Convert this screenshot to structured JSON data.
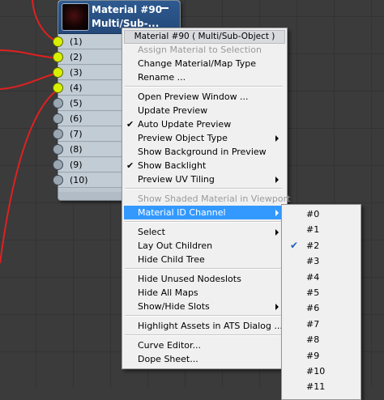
{
  "node": {
    "title": "Material #90",
    "subtitle": "Multi/Sub-...",
    "slots": [
      {
        "label": "(1)",
        "connected": true
      },
      {
        "label": "(2)",
        "connected": true
      },
      {
        "label": "(3)",
        "connected": true
      },
      {
        "label": "(4)",
        "connected": true
      },
      {
        "label": "(5)",
        "connected": false
      },
      {
        "label": "(6)",
        "connected": false
      },
      {
        "label": "(7)",
        "connected": false
      },
      {
        "label": "(8)",
        "connected": false
      },
      {
        "label": "(9)",
        "connected": false
      },
      {
        "label": "(10)",
        "connected": false
      }
    ]
  },
  "menu": {
    "header": "Material #90  ( Multi/Sub-Object )",
    "items": [
      {
        "label": "Assign Material to Selection",
        "disabled": true
      },
      {
        "label": "Change Material/Map Type"
      },
      {
        "label": "Rename ..."
      },
      {
        "label": "Open Preview Window ..."
      },
      {
        "label": "Update Preview"
      },
      {
        "label": "Auto Update Preview",
        "checked": true
      },
      {
        "label": "Preview Object Type",
        "submenu": true
      },
      {
        "label": "Show Background in Preview"
      },
      {
        "label": "Show Backlight",
        "checked": true
      },
      {
        "label": "Preview UV Tiling",
        "submenu": true
      },
      {
        "label": "Show Shaded Material in Viewport",
        "disabled": true
      },
      {
        "label": "Material ID Channel",
        "submenu": true,
        "highlighted": true
      },
      {
        "label": "Select",
        "submenu": true
      },
      {
        "label": "Lay Out Children"
      },
      {
        "label": "Hide Child Tree"
      },
      {
        "label": "Hide Unused Nodeslots"
      },
      {
        "label": "Hide All Maps"
      },
      {
        "label": "Show/Hide Slots",
        "submenu": true
      },
      {
        "label": "Highlight Assets in ATS Dialog ..."
      },
      {
        "label": "Curve Editor..."
      },
      {
        "label": "Dope Sheet..."
      }
    ]
  },
  "submenu": {
    "items": [
      "#0",
      "#1",
      "#2",
      "#3",
      "#4",
      "#5",
      "#6",
      "#7",
      "#8",
      "#9",
      "#10",
      "#11"
    ],
    "checked": "#2"
  }
}
